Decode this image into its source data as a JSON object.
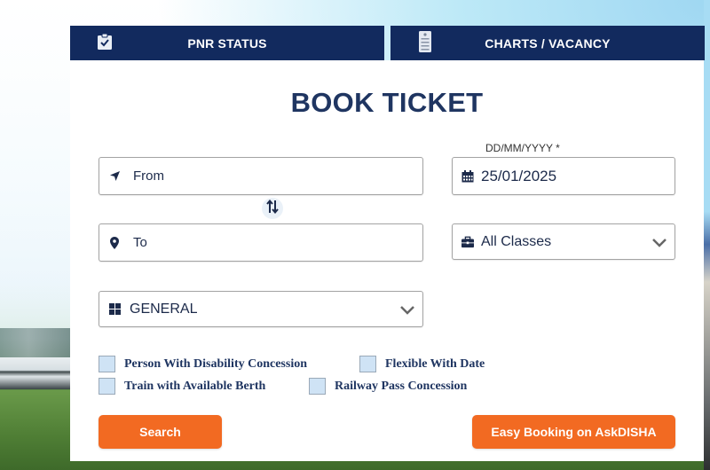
{
  "tabs": [
    {
      "label": "PNR STATUS",
      "icon": "clipboard-check-icon"
    },
    {
      "label": "CHARTS / VACANCY",
      "icon": "chart-list-icon"
    }
  ],
  "form": {
    "title": "BOOK TICKET",
    "from": {
      "placeholder": "From",
      "value": "",
      "icon": "location-arrow-icon"
    },
    "to": {
      "placeholder": "To",
      "value": "",
      "icon": "map-marker-icon"
    },
    "swap_icon": "swap-arrows-icon",
    "date": {
      "label": "DD/MM/YYYY *",
      "value": "25/01/2025",
      "icon": "calendar-icon"
    },
    "class": {
      "selected": "All Classes",
      "icon": "briefcase-icon"
    },
    "quota": {
      "selected": "GENERAL",
      "icon": "grid-icon"
    },
    "options": [
      {
        "label": "Person With Disability Concession",
        "checked": false
      },
      {
        "label": "Flexible With Date",
        "checked": false
      },
      {
        "label": "Train with Available Berth",
        "checked": false
      },
      {
        "label": "Railway Pass Concession",
        "checked": false
      }
    ],
    "search_label": "Search",
    "disha_label": "Easy Booking on AskDISHA"
  },
  "colors": {
    "navy": "#122a5e",
    "title": "#1f3561",
    "accent_orange": "#f26a22",
    "checkbox_fill": "#cfe3f5"
  }
}
